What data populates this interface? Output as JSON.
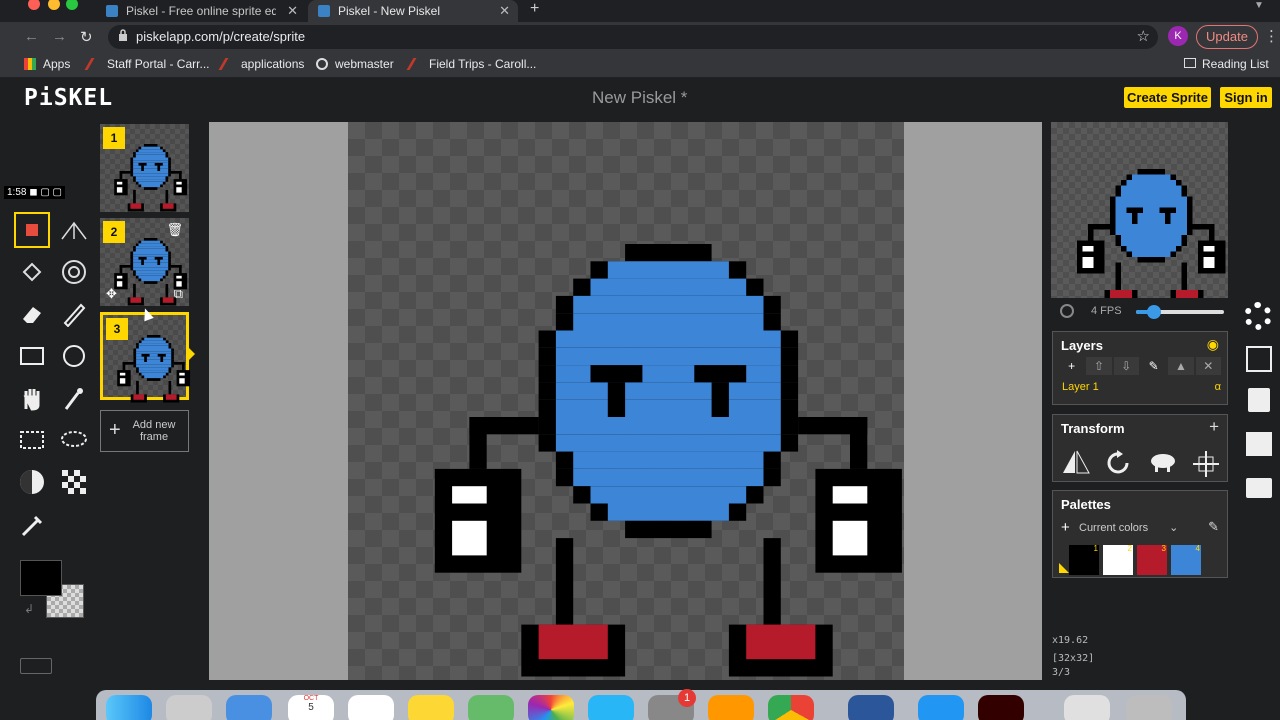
{
  "browser": {
    "tabs": [
      {
        "title": "Piskel - Free online sprite edito",
        "active": false
      },
      {
        "title": "Piskel - New Piskel",
        "active": true
      }
    ],
    "url": "piskelapp.com/p/create/sprite",
    "avatar_letter": "K",
    "update_label": "Update",
    "bookmarks": [
      "Apps",
      "Staff Portal - Carr...",
      "applications",
      "webmaster",
      "Field Trips - Caroll..."
    ],
    "reading_list": "Reading List"
  },
  "app": {
    "logo": "PiSKEL",
    "title": "New Piskel *",
    "create_sprite": "Create Sprite",
    "sign_in": "Sign in"
  },
  "tools": {
    "timer": "1:58",
    "primary_color": "#000000",
    "selected_tool": "pen-tool"
  },
  "frames": {
    "items": [
      {
        "number": "1",
        "active": false
      },
      {
        "number": "2",
        "active": false
      },
      {
        "number": "3",
        "active": true
      }
    ],
    "add_label": "Add new frame"
  },
  "preview": {
    "fps": "4 FPS",
    "fps_value": 4,
    "fps_max": 24
  },
  "layers": {
    "title": "Layers",
    "items": [
      {
        "name": "Layer 1",
        "alpha_symbol": "α"
      }
    ]
  },
  "transform": {
    "title": "Transform"
  },
  "palettes": {
    "title": "Palettes",
    "selected": "Current colors",
    "swatches": [
      {
        "index": "1",
        "color": "#000000"
      },
      {
        "index": "2",
        "color": "#ffffff"
      },
      {
        "index": "3",
        "color": "#b51b2a"
      },
      {
        "index": "4",
        "color": "#3d85d6"
      }
    ]
  },
  "status": {
    "zoom": "x19.62",
    "size": "[32x32]",
    "frame": "3/3"
  },
  "sprite": {
    "body_color": "#3d85d6",
    "outline_color": "#000000",
    "foot_color": "#b51b2a",
    "glove_color": "#ffffff"
  },
  "dock": {
    "calendar_month": "OCT",
    "calendar_day": "5",
    "badge": "1"
  }
}
